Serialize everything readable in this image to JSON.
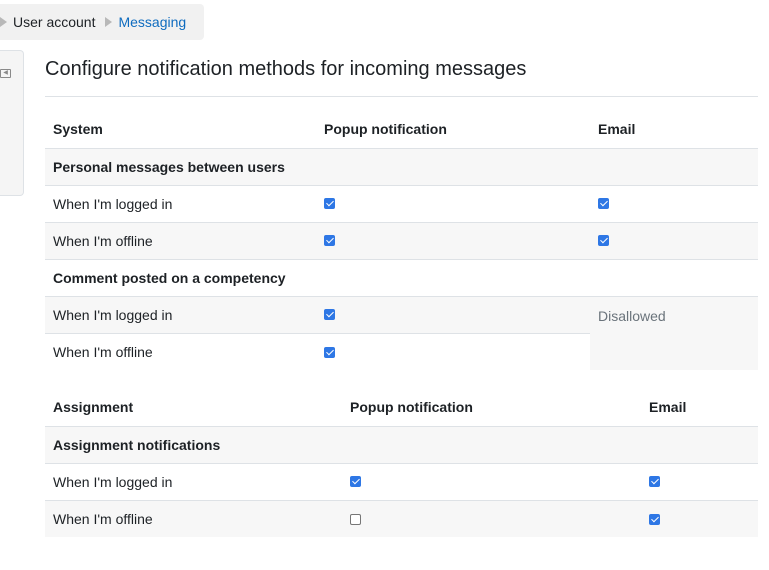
{
  "breadcrumb": {
    "items": [
      "User account",
      "Messaging"
    ]
  },
  "page_title": "Configure notification methods for incoming messages",
  "system_table": {
    "headers": [
      "System",
      "Popup notification",
      "Email"
    ],
    "groups": [
      {
        "title": "Personal messages between users",
        "rows": [
          {
            "label": "When I'm logged in",
            "popup": true,
            "email": true
          },
          {
            "label": "When I'm offline",
            "popup": true,
            "email": true
          }
        ]
      },
      {
        "title": "Comment posted on a competency",
        "rows": [
          {
            "label": "When I'm logged in",
            "popup": true
          },
          {
            "label": "When I'm offline",
            "popup": true
          }
        ],
        "email_status": "Disallowed"
      }
    ]
  },
  "assignment_table": {
    "headers": [
      "Assignment",
      "Popup notification",
      "Email"
    ],
    "groups": [
      {
        "title": "Assignment notifications",
        "rows": [
          {
            "label": "When I'm logged in",
            "popup": true,
            "email": true
          },
          {
            "label": "When I'm offline",
            "popup": false,
            "email": true
          }
        ]
      }
    ]
  },
  "colors": {
    "link": "#0f6cbf",
    "checkbox": "#2e77e5",
    "stripe": "#f7f7f7"
  }
}
